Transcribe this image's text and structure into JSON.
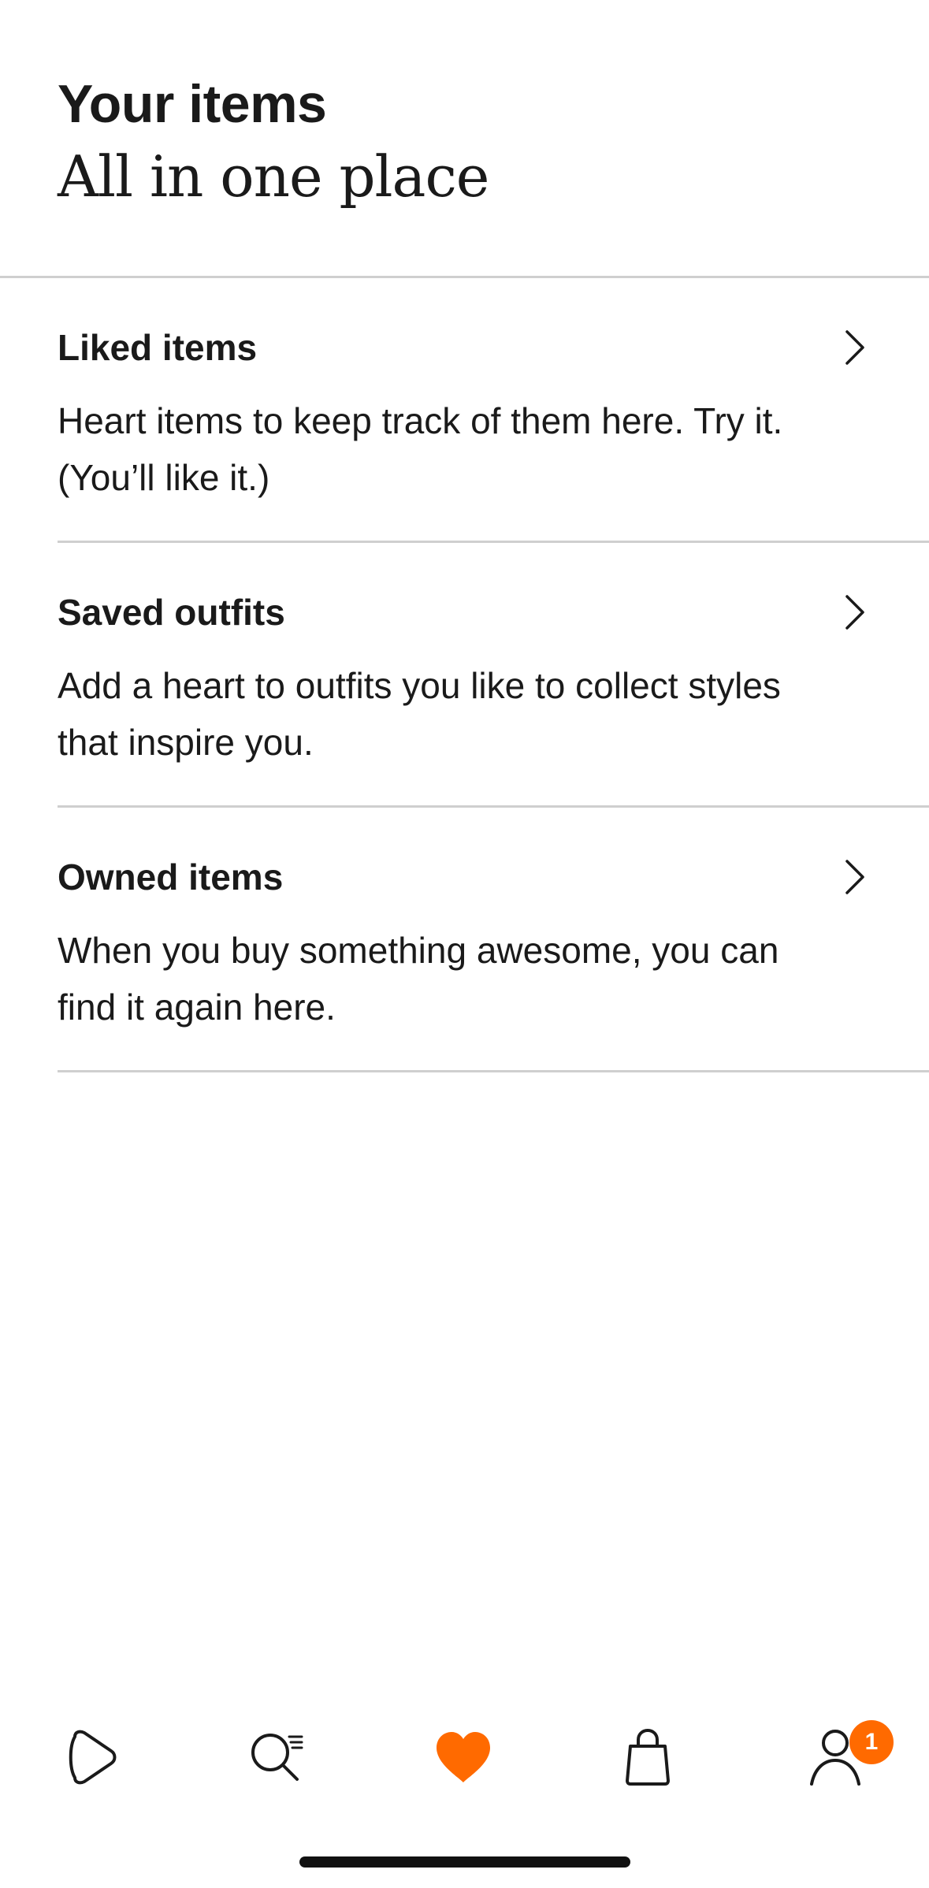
{
  "header": {
    "title": "Your items",
    "subtitle": "All in one place"
  },
  "items": [
    {
      "title": "Liked items",
      "description": "Heart items to keep track of them here. Try it. (You’ll like it.)"
    },
    {
      "title": "Saved outfits",
      "description": "Add a heart to outfits you like to collect styles that inspire you."
    },
    {
      "title": "Owned items",
      "description": "When you buy something awesome, you can find it again here."
    }
  ],
  "tabbar": {
    "tabs": [
      {
        "icon": "play-icon",
        "active": false
      },
      {
        "icon": "search-icon",
        "active": false
      },
      {
        "icon": "heart-icon",
        "active": true
      },
      {
        "icon": "bag-icon",
        "active": false
      },
      {
        "icon": "profile-icon",
        "active": false
      }
    ],
    "profile_badge": "1",
    "accent_color": "#ff6a00"
  }
}
